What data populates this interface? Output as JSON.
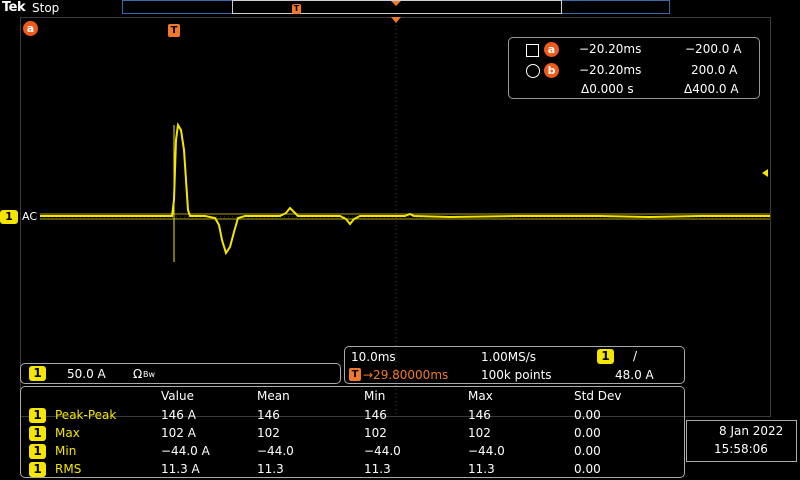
{
  "header": {
    "brand": "Tek",
    "status": "Stop"
  },
  "markers": {
    "a": "a",
    "b": "b",
    "trigger": "T"
  },
  "channel": {
    "number": "1",
    "coupling": "AC"
  },
  "cursors": {
    "a": {
      "time": "−20.20ms",
      "value": "−200.0 A"
    },
    "b": {
      "time": "−20.20ms",
      "value": "200.0 A"
    },
    "delta": {
      "time": "Δ0.000 s",
      "value": "Δ400.0 A"
    }
  },
  "channel_panel": {
    "scale": "50.0 A",
    "impedance": "Ω",
    "bw": "Bᴡ"
  },
  "timebase": {
    "scale": "10.0ms",
    "rate": "1.00MS/s",
    "trigger_pos": "→29.80000ms",
    "points": "100k points",
    "trigger_level": "48.0 A",
    "trigger_slope": "/"
  },
  "measurements": {
    "headers": [
      "Value",
      "Mean",
      "Min",
      "Max",
      "Std Dev"
    ],
    "rows": [
      {
        "name": "Peak-Peak",
        "value": "146 A",
        "mean": "146",
        "min": "146",
        "max": "146",
        "std": "0.00"
      },
      {
        "name": "Max",
        "value": "102 A",
        "mean": "102",
        "min": "102",
        "max": "102",
        "std": "0.00"
      },
      {
        "name": "Min",
        "value": "−44.0 A",
        "mean": "−44.0",
        "min": "−44.0",
        "max": "−44.0",
        "std": "0.00"
      },
      {
        "name": "RMS",
        "value": "11.3 A",
        "mean": "11.3",
        "min": "11.3",
        "max": "11.3",
        "std": "0.00"
      }
    ]
  },
  "datetime": {
    "date": "8 Jan  2022",
    "time": "15:58:06"
  },
  "colors": {
    "trace": "#f5e600",
    "marker": "#f05a1a",
    "grid": "#3b3b3b"
  }
}
